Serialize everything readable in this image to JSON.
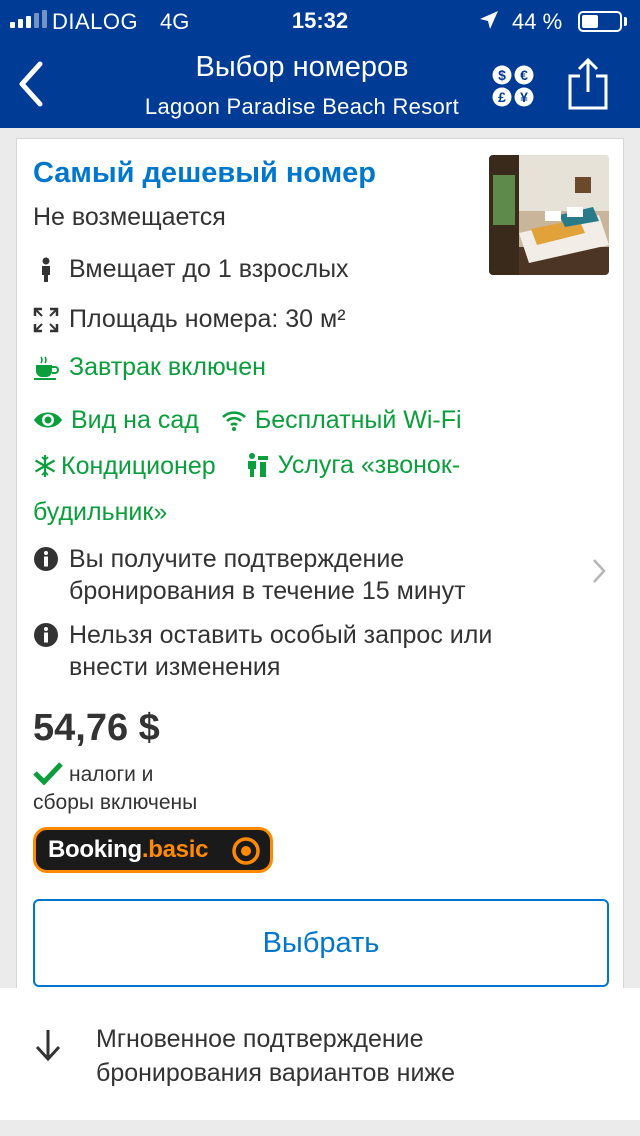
{
  "status_bar": {
    "carrier": "DIALOG",
    "network": "4G",
    "time": "15:32",
    "battery_percent": "44 %",
    "battery_level": 0.44
  },
  "nav": {
    "title": "Выбор номеров",
    "subtitle": "Lagoon Paradise Beach Resort",
    "back_icon": "chevron-left-icon",
    "currency_icon": "currency-icon",
    "share_icon": "share-icon"
  },
  "room": {
    "title": "Самый дешевый номер",
    "refund_policy": "Не возмещается",
    "occupancy": "Вмещает до 1 взрослых",
    "area": "Площадь номера: 30 м²",
    "breakfast": "Завтрак включен",
    "amenities": {
      "garden_view": "Вид на сад",
      "wifi": "Бесплатный Wi-Fi",
      "ac": "Кондиционер",
      "wakeup_line1": "Услуга «звонок-",
      "wakeup_line2": "будильник»"
    },
    "confirmation_line1": "Вы получите подтверждение",
    "confirmation_line2": "бронирования в течение 15 минут",
    "requests_line1": "Нельзя оставить особый запрос или",
    "requests_line2": "внести изменения",
    "price": "54,76 $",
    "taxes_line1": "налоги и",
    "taxes_line2": "сборы включены",
    "badge_main": "Booking",
    "badge_accent": ".basic",
    "select_button": "Выбрать"
  },
  "notice": {
    "line1": "Мгновенное подтверждение",
    "line2": "бронирования вариантов ниже"
  },
  "colors": {
    "nav_bg": "#003b95",
    "link_blue": "#0077cc",
    "green": "#0a9e3c",
    "badge_orange": "#ff8a00"
  }
}
